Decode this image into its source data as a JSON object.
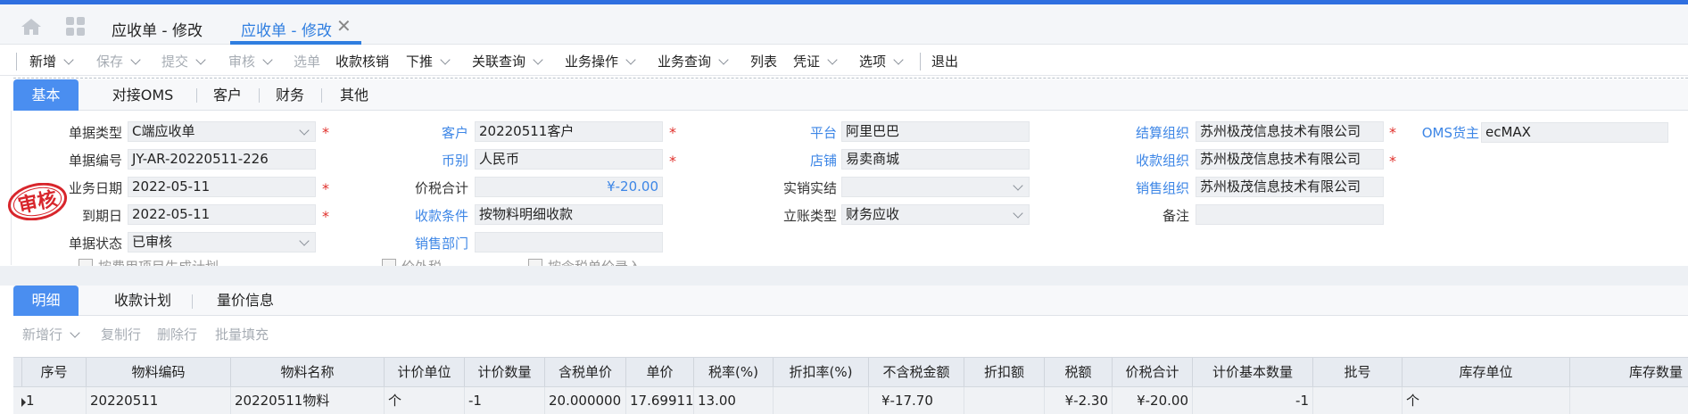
{
  "tabs": {
    "tab1": "应收单 - 修改",
    "tab2": "应收单 - 修改"
  },
  "toolbar": {
    "new": "新增",
    "save": "保存",
    "submit": "提交",
    "audit": "审核",
    "select": "选单",
    "verify": "收款核销",
    "push": "下推",
    "related": "关联查询",
    "bizop": "业务操作",
    "bizquery": "业务查询",
    "list": "列表",
    "voucher": "凭证",
    "options": "选项",
    "exit": "退出"
  },
  "form_tabs": [
    "基本",
    "对接OMS",
    "客户",
    "财务",
    "其他"
  ],
  "form": {
    "doc_type_label": "单据类型",
    "doc_type": "C端应收单",
    "doc_no_label": "单据编号",
    "doc_no": "JY-AR-20220511-226",
    "biz_date_label": "业务日期",
    "biz_date": "2022-05-11",
    "due_date_label": "到期日",
    "due_date": "2022-05-11",
    "status_label": "单据状态",
    "status": "已审核",
    "customer_label": "客户",
    "customer": "20220511客户",
    "currency_label": "币别",
    "currency": "人民币",
    "total_label": "价税合计",
    "total": "¥-20.00",
    "terms_label": "收款条件",
    "terms": "按物料明细收款",
    "dept_label": "销售部门",
    "dept": "",
    "platform_label": "平台",
    "platform": "阿里巴巴",
    "shop_label": "店铺",
    "shop": "易卖商城",
    "actual_label": "实销实结",
    "actual": "",
    "account_type_label": "立账类型",
    "account_type": "财务应收",
    "settle_org_label": "结算组织",
    "settle_org": "苏州极茂信息技术有限公司",
    "receive_org_label": "收款组织",
    "receive_org": "苏州极茂信息技术有限公司",
    "sales_org_label": "销售组织",
    "sales_org": "苏州极茂信息技术有限公司",
    "remark_label": "备注",
    "remark": "",
    "oms_owner_label": "OMS货主",
    "oms_owner": "ecMAX",
    "stamp_text": "审核",
    "cb1": "按费用项目生成计划",
    "cb2": "价外税",
    "cb3": "按含税单价录入"
  },
  "detail_tabs": [
    "明细",
    "收款计划",
    "量价信息"
  ],
  "detail_toolbar": [
    "新增行",
    "复制行",
    "删除行",
    "批量填充"
  ],
  "grid": {
    "headers": [
      "序号",
      "物料编码",
      "物料名称",
      "计价单位",
      "计价数量",
      "含税单价",
      "单价",
      "税率(%)",
      "折扣率(%)",
      "不含税金额",
      "折扣额",
      "税额",
      "价税合计",
      "计价基本数量",
      "批号",
      "库存单位",
      "库存数量"
    ],
    "rows": [
      [
        "1",
        "20220511",
        "20220511物料",
        "个",
        "-1",
        "20.000000",
        "17.699115",
        "13.00",
        "",
        "¥-17.70",
        "",
        "¥-2.30",
        "¥-20.00",
        "-1",
        "",
        "个",
        ""
      ]
    ]
  },
  "colors": {
    "accent": "#2f6fe0",
    "tab_active": "#4a8ef0",
    "link_label": "#3d86e6",
    "required": "#e0302b",
    "stamp": "#d8262c"
  }
}
